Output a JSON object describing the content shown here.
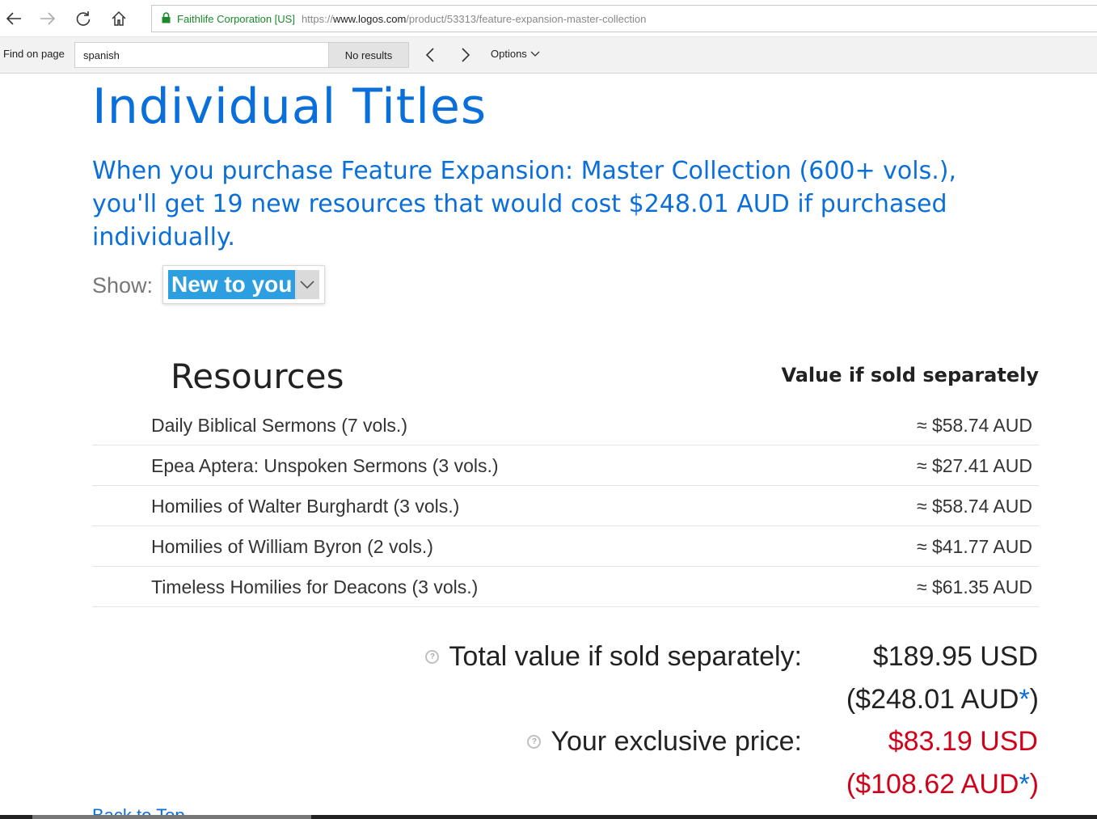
{
  "browser": {
    "org": "Faithlife Corporation [US]",
    "url_scheme": "https://",
    "url_host": "www.logos.com",
    "url_path": "/product/53313/feature-expansion-master-collection"
  },
  "find": {
    "label": "Find on page",
    "query": "spanish",
    "results": "No results",
    "options_label": "Options"
  },
  "page": {
    "title": "Individual Titles",
    "intro": "When you purchase Feature Expansion: Master Collection (600+ vols.), you'll get 19 new resources that would cost $248.01 AUD if purchased individually.",
    "show_label": "Show:",
    "show_value": "New to you",
    "resources_header": "Resources",
    "value_header": "Value if sold separately",
    "resources": [
      {
        "name": "Daily Biblical Sermons (7 vols.)",
        "price": "≈ $58.74 AUD"
      },
      {
        "name": "Epea Aptera: Unspoken Sermons (3 vols.)",
        "price": "≈ $27.41 AUD"
      },
      {
        "name": "Homilies of Walter Burghardt (3 vols.)",
        "price": "≈ $58.74 AUD"
      },
      {
        "name": "Homilies of William Byron (2 vols.)",
        "price": "≈ $41.77 AUD"
      },
      {
        "name": "Timeless Homilies for Deacons (3 vols.)",
        "price": "≈ $61.35 AUD"
      }
    ],
    "total_label": "Total value if sold separately:",
    "total_usd": "$189.95 USD",
    "total_aud_open": "($248.01 AUD",
    "total_aud_star": "*",
    "total_aud_close": ")",
    "price_label": "Your exclusive price:",
    "price_usd": "$83.19 USD",
    "price_aud_open": "($108.62 AUD",
    "price_aud_star": "*",
    "price_aud_close": ")",
    "back_to_top": "Back to Top"
  }
}
